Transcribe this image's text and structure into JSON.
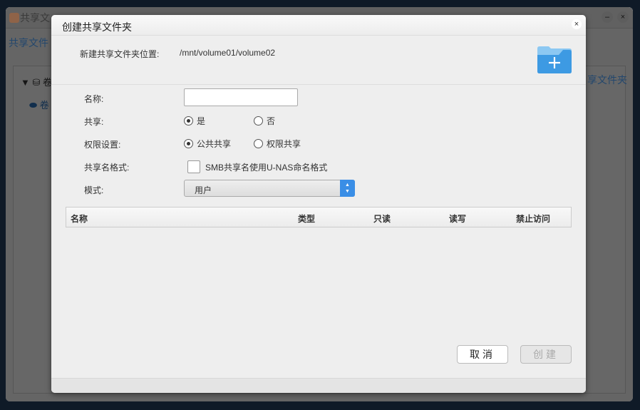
{
  "background_window": {
    "title": "共享文",
    "tab": "共享文件",
    "tree_root": "卷",
    "tree_child": "卷",
    "right_button": "享文件夹",
    "minimize": "–",
    "close": "×"
  },
  "dialog": {
    "title": "创建共享文件夹",
    "close": "×",
    "location_label": "新建共享文件夹位置:",
    "location_value": "/mnt/volume01/volume02",
    "name_label": "名称:",
    "name_value": "",
    "share_label": "共享:",
    "share_yes": "是",
    "share_no": "否",
    "perm_label": "权限设置:",
    "perm_public": "公共共享",
    "perm_restricted": "权限共享",
    "format_label": "共享名格式:",
    "format_checkbox": "SMB共享名使用U-NAS命名格式",
    "mode_label": "模式:",
    "mode_value": "用户",
    "table_headers": [
      "名称",
      "类型",
      "只读",
      "读写",
      "禁止访问"
    ],
    "cancel": "取消",
    "create": "创建"
  }
}
